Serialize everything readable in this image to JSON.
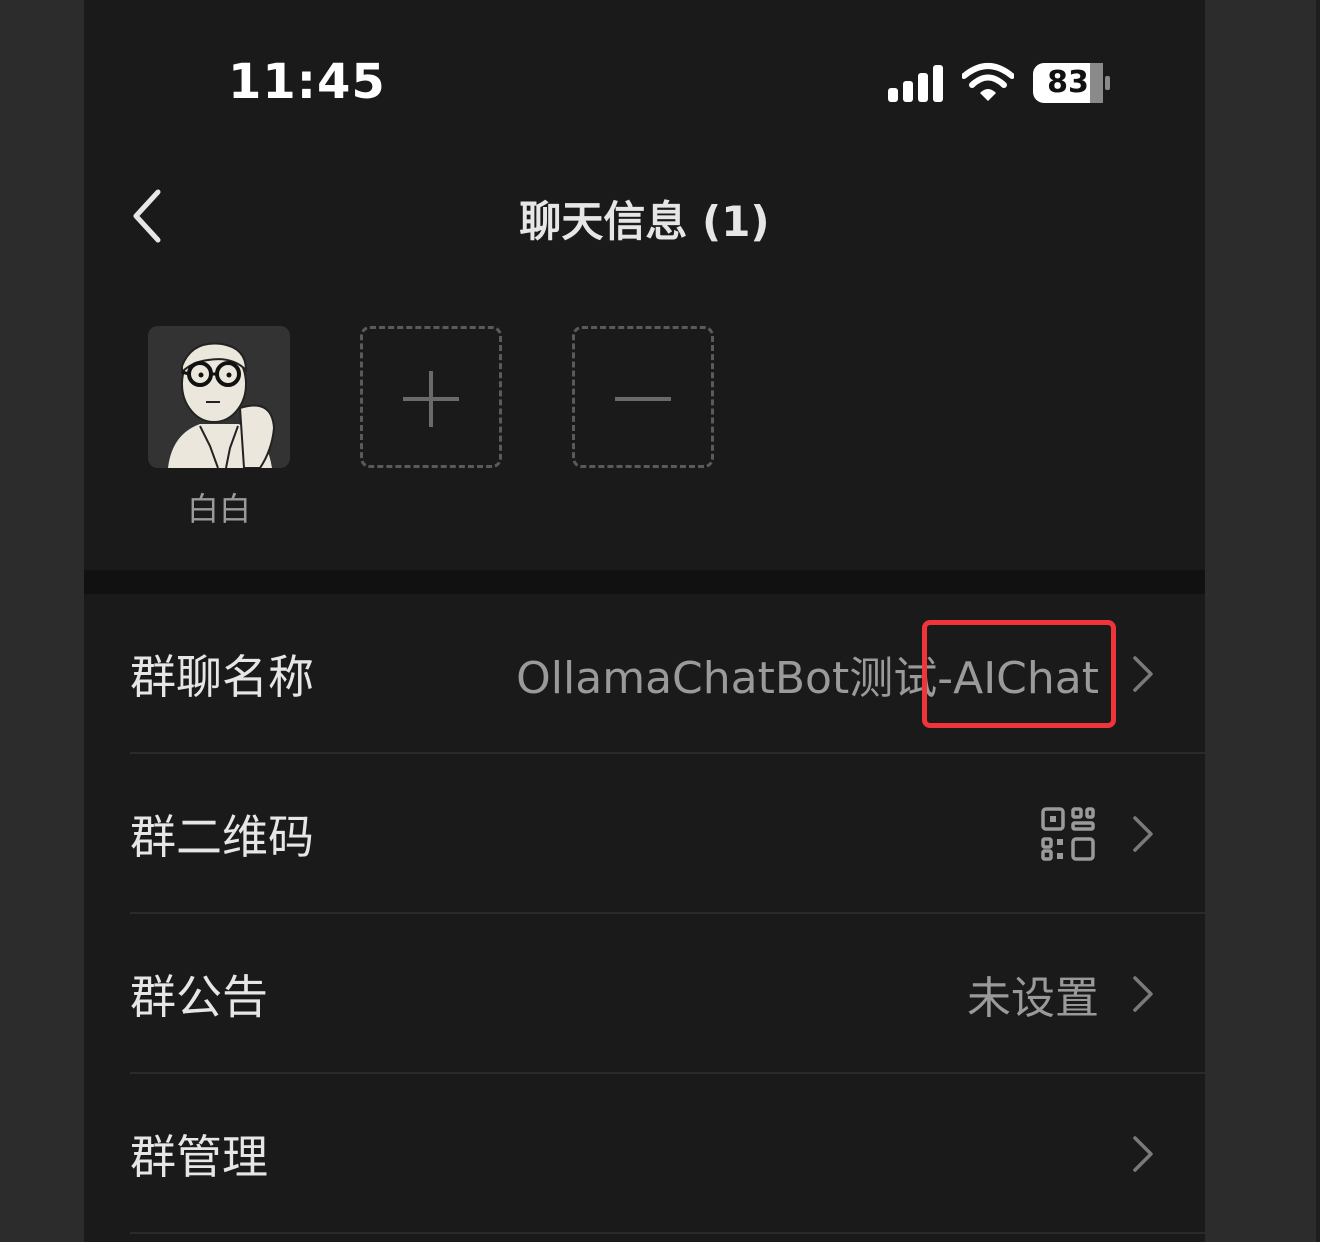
{
  "status_bar": {
    "time": "11:45",
    "battery": "83",
    "icons": [
      "signal-icon",
      "wifi-icon",
      "battery-icon"
    ]
  },
  "nav": {
    "back_icon": "chevron-left-icon",
    "title": "聊天信息 (1)"
  },
  "members": {
    "items": [
      {
        "name": "白白",
        "avatar": "cartoon-person-with-glasses-avatar"
      }
    ],
    "add_icon": "plus-icon",
    "remove_icon": "minus-icon"
  },
  "settings": {
    "rows": [
      {
        "label": "群聊名称",
        "value": "OllamaChatBot测试-AIChat"
      },
      {
        "label": "群二维码",
        "value": "",
        "icon": "qr-code-icon"
      },
      {
        "label": "群公告",
        "value": "未设置"
      },
      {
        "label": "群管理",
        "value": ""
      }
    ]
  },
  "colors": {
    "background": "#1a1a1a",
    "text_primary": "#e6e6e6",
    "text_secondary": "#9a9a9a",
    "highlight": "#f0343a"
  }
}
